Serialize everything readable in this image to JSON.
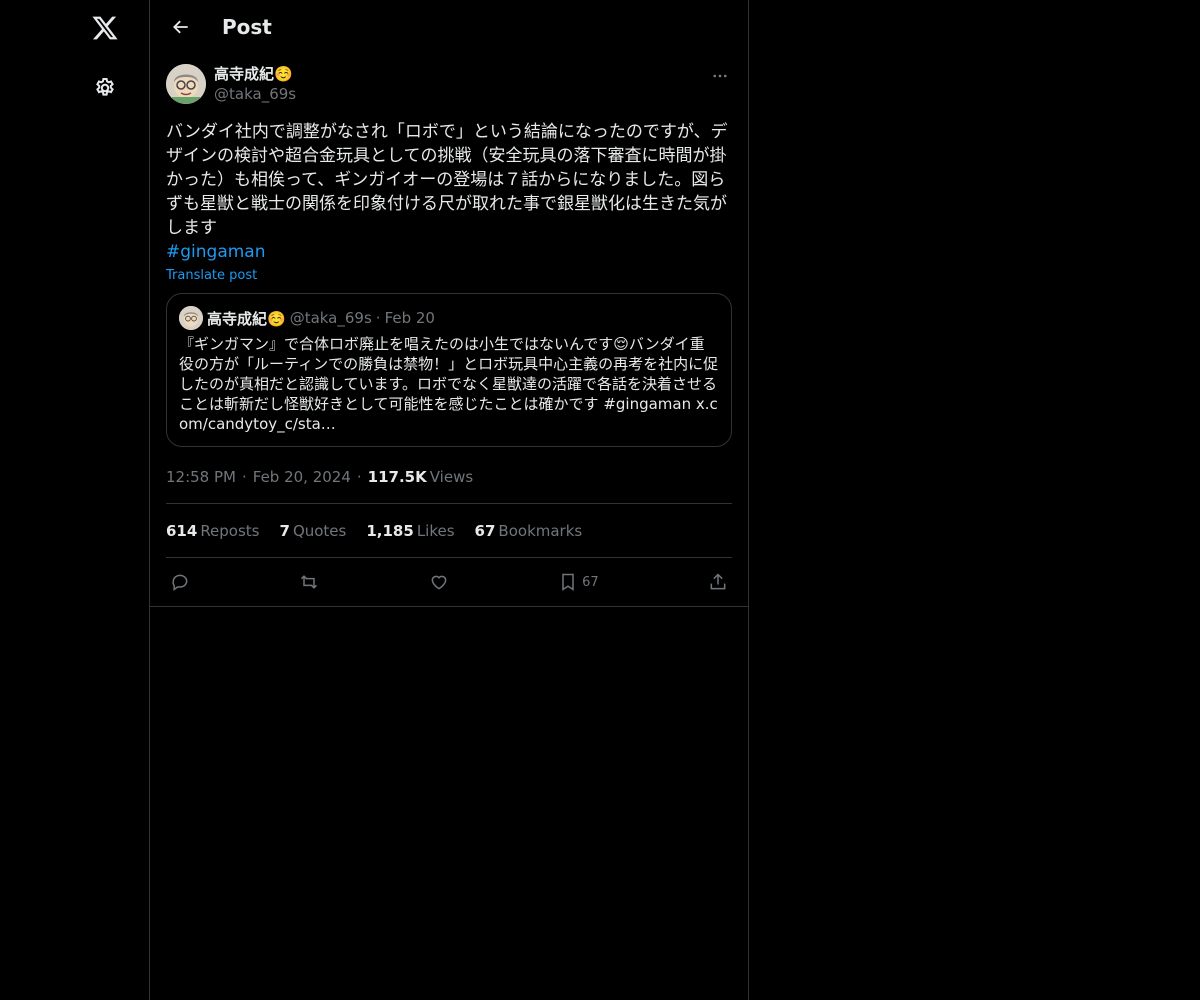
{
  "header": {
    "title": "Post"
  },
  "post": {
    "display_name": "高寺成紀☺️",
    "handle": "@taka_69s",
    "text": "バンダイ社内で調整がなされ「ロボで」という結論になったのですが、デザインの検討や超合金玩具としての挑戦（安全玩具の落下審査に時間が掛かった）も相俟って、ギンガイオーの登場は７話からになりました。図らずも星獣と戦士の関係を印象付ける尺が取れた事で銀星獣化は生きた気がします",
    "hashtag": "#gingaman",
    "translate_label": "Translate post",
    "quote": {
      "display_name": "高寺成紀☺️",
      "handle": "@taka_69s",
      "date": "Feb 20",
      "text": "『ギンガマン』で合体ロボ廃止を唱えたのは小生ではないんです😌バンダイ重役の方が「ルーティンでの勝負は禁物！」とロボ玩具中心主義の再考を社内に促したのが真相だと認識しています。ロボでなく星獣達の活躍で各話を決着させることは斬新だし怪獣好きとして可能性を感じたことは確かです #gingaman x.com/candytoy_c/sta…"
    },
    "time": "12:58 PM",
    "date": "Feb 20, 2024",
    "views_count": "117.5K",
    "views_label": "Views",
    "stats": {
      "reposts_count": "614",
      "reposts_label": "Reposts",
      "quotes_count": "7",
      "quotes_label": "Quotes",
      "likes_count": "1,185",
      "likes_label": "Likes",
      "bookmarks_count": "67",
      "bookmarks_label": "Bookmarks"
    },
    "actions": {
      "bookmark_count": "67"
    }
  },
  "icons": {
    "logo": "x-logo-icon",
    "settings": "gear-icon",
    "back": "arrow-left-icon",
    "more": "more-horizontal-icon",
    "reply": "reply-icon",
    "repost": "repost-icon",
    "like": "heart-icon",
    "bookmark": "bookmark-icon",
    "share": "share-icon"
  },
  "colors": {
    "accent": "#1d9bf0",
    "muted": "#71767b",
    "background": "#000000"
  }
}
